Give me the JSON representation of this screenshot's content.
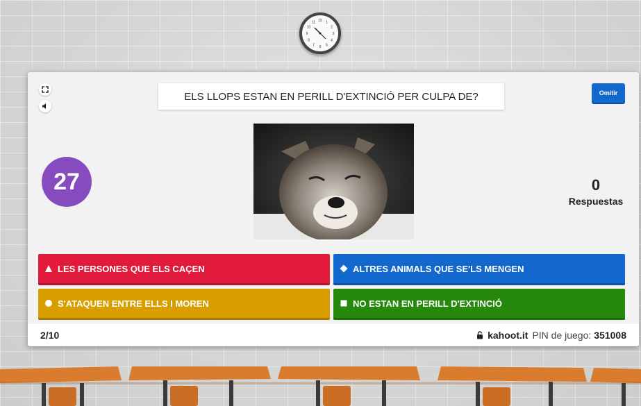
{
  "clock": {
    "numbers": [
      "12",
      "1",
      "2",
      "3",
      "4",
      "5",
      "6",
      "7",
      "8",
      "9",
      "10",
      "11"
    ]
  },
  "toolbar": {
    "fullscreen_icon": "fullscreen-icon",
    "sound_icon": "speaker-icon"
  },
  "question": {
    "text": "ELS LLOPS ESTAN EN PERILL D'EXTINCIÓ PER CULPA DE?",
    "image_desc": "wolf"
  },
  "skip_label": "Omitir",
  "timer": {
    "value": "27",
    "color": "#864cbf"
  },
  "answers_count": {
    "value": "0",
    "label": "Respuestas"
  },
  "answers": [
    {
      "shape": "triangle-icon",
      "text": "LES PERSONES QUE ELS CAÇEN",
      "color": "#e21b3c"
    },
    {
      "shape": "diamond-icon",
      "text": "ALTRES ANIMALS QUE SE'LS MENGEN",
      "color": "#1368ce"
    },
    {
      "shape": "circle-icon",
      "text": "S'ATAQUEN ENTRE ELLS I MOREN",
      "color": "#d89e00"
    },
    {
      "shape": "square-icon",
      "text": "NO ESTAN EN PERILL D'EXTINCIÓ",
      "color": "#26890c"
    }
  ],
  "footer": {
    "progress": "2/10",
    "site": "kahoot.it",
    "pin_label": "PIN de juego:",
    "pin": "351008"
  }
}
